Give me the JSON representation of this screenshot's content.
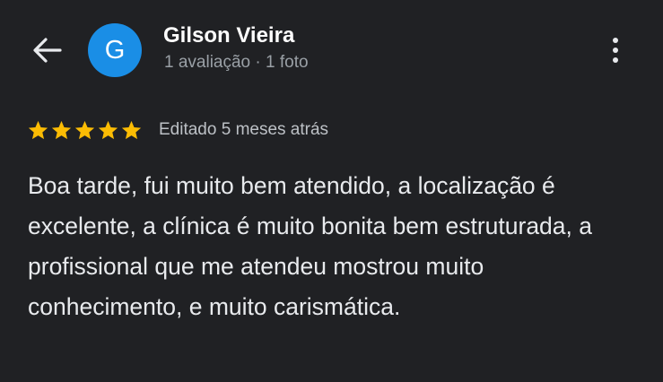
{
  "header": {
    "back_icon": "arrow-left-icon",
    "avatar_letter": "G",
    "user_name": "Gilson Vieira",
    "user_meta": "1 avaliação · 1 foto",
    "more_icon": "more-vert-icon"
  },
  "review": {
    "rating": 5,
    "max_rating": 5,
    "edited_label": "Editado 5 meses atrás",
    "text": "Boa tarde, fui muito bem atendido, a localização é excelente, a clínica é muito bonita bem estruturada, a profissional que me atendeu mostrou muito conhecimento, e muito carismática."
  },
  "colors": {
    "background": "#202124",
    "avatar": "#1a8ee6",
    "star": "#fbbc04",
    "primary_text": "#e8eaed",
    "secondary_text": "#9aa0a6"
  }
}
